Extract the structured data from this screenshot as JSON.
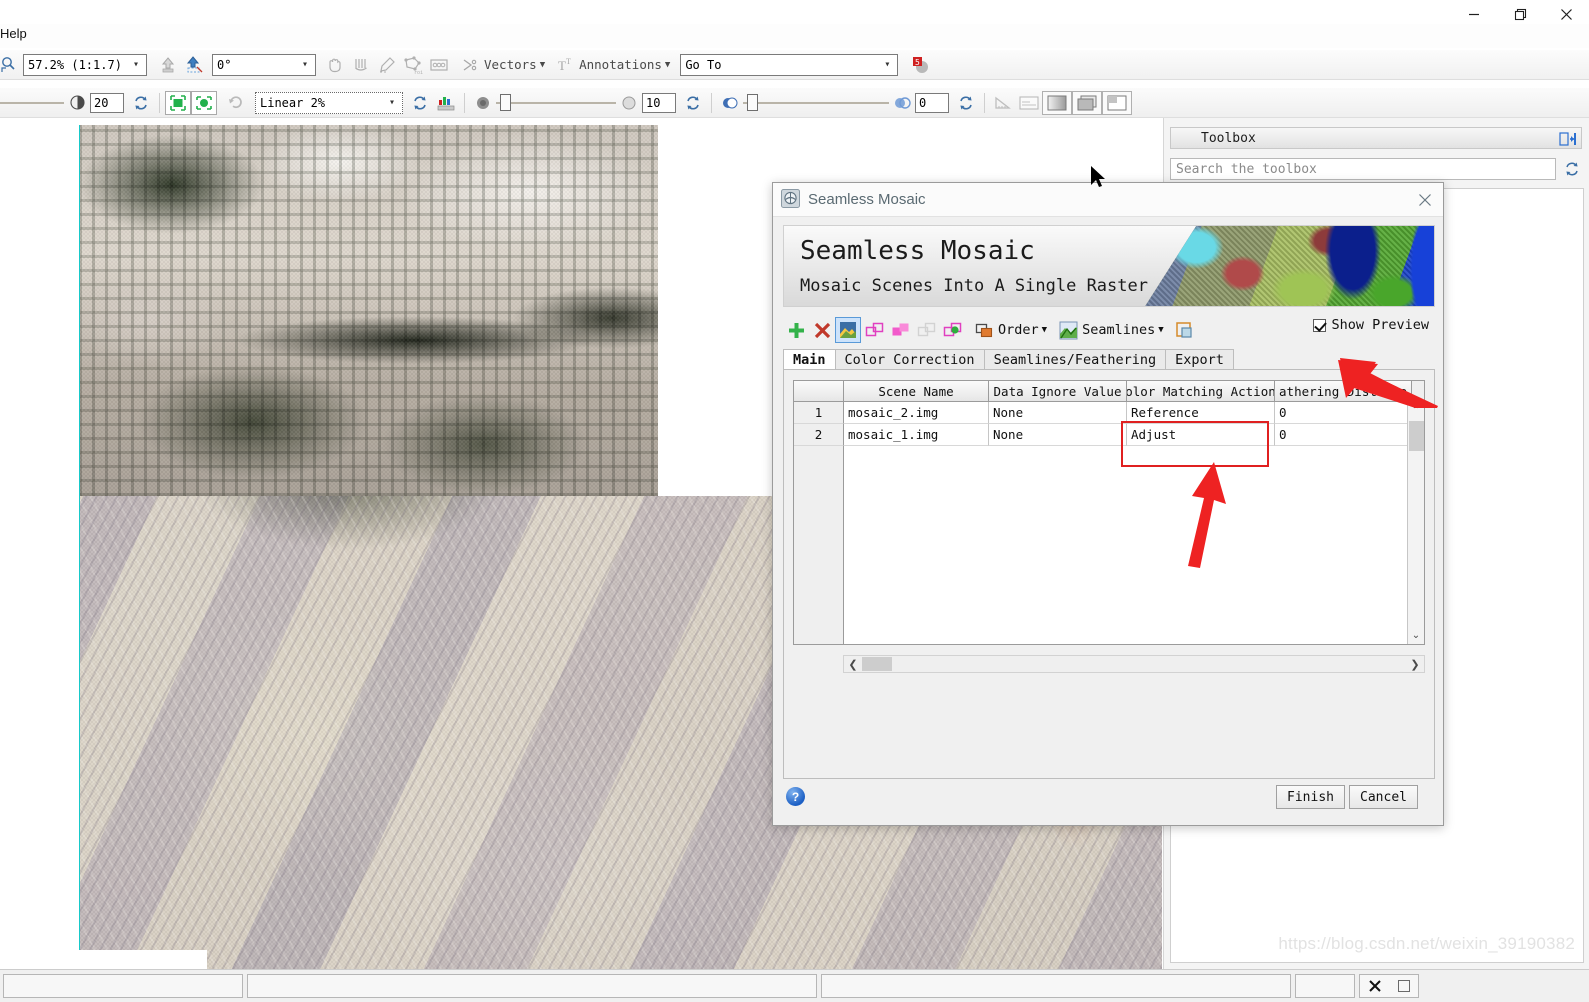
{
  "window": {
    "controls": [
      {
        "name": "minimize",
        "glyph": "—"
      },
      {
        "name": "restore",
        "glyph": "❐"
      },
      {
        "name": "close",
        "glyph": "✕"
      }
    ]
  },
  "menu": {
    "help_label": "Help"
  },
  "toolbar_main": {
    "zoom_combo_value": "57.2% (1:1.7)",
    "rotation_combo_value": "0°",
    "vectors_label": "Vectors",
    "annotations_label": "Annotations",
    "goto_value": "Go To",
    "icons": [
      "zoom-select-icon",
      "go-up-icon",
      "go-up-layer-icon",
      "pan-hand-icon",
      "crop-icon",
      "pencil-measure-icon",
      "roi-icon",
      "pixel-locator-icon",
      "vectors-icon",
      "annotations-icon",
      "envi-logo-icon"
    ]
  },
  "toolbar_display": {
    "contrast_value": "20",
    "stretch_value": "Linear 2%",
    "transparency_value": "10",
    "blend_value": "0",
    "icons": [
      "brightness-icon",
      "refresh-icon",
      "fit-to-window-icon",
      "fit-to-data-icon",
      "rotate-reset-icon",
      "stretch-refresh-icon",
      "histogram-icon",
      "transparency-icon",
      "blend-icon",
      "measure-icon",
      "view-metadata-icon",
      "view-single-icon",
      "view-stacked-icon",
      "view-portal-icon"
    ]
  },
  "viewport": {
    "layer_name": "satellite-mosaic-preview"
  },
  "toolbox": {
    "title": "Toolbox",
    "search_placeholder": "Search the toolbox",
    "pin_icon": "dock-pin-icon",
    "refresh_icon": "refresh-icon"
  },
  "watermark": {
    "text": "https://blog.csdn.net/weixin_39190382"
  },
  "dialog": {
    "title": "Seamless Mosaic",
    "close_glyph": "✕",
    "banner_title": "Seamless Mosaic",
    "banner_subtitle": "Mosaic Scenes Into A Single Raster",
    "toolbar": {
      "add_label": "add-scene",
      "remove_label": "remove-scene",
      "order_label": "Order",
      "seamlines_label": "Seamlines",
      "show_preview_label": "Show Preview",
      "show_preview_checked": true,
      "icons": [
        "add-plus-icon",
        "delete-x-icon",
        "image-properties-icon",
        "scene-outline-icon",
        "scene-filled-icon",
        "scene-blank-icon",
        "scene-green-icon",
        "order-icon",
        "seamlines-icon",
        "preview-extent-icon"
      ]
    },
    "tabs": [
      {
        "label": "Main",
        "active": true
      },
      {
        "label": "Color Correction",
        "active": false
      },
      {
        "label": "Seamlines/Feathering",
        "active": false
      },
      {
        "label": "Export",
        "active": false
      }
    ],
    "table": {
      "columns": [
        "",
        "Scene Name",
        "Data Ignore Value",
        "olor Matching Action",
        "athering Distance"
      ],
      "rows": [
        {
          "index": "1",
          "scene_name": "mosaic_2.img",
          "data_ignore_value": "None",
          "color_matching_action": "Reference",
          "feathering_distance": "0"
        },
        {
          "index": "2",
          "scene_name": "mosaic_1.img",
          "data_ignore_value": "None",
          "color_matching_action": "Adjust",
          "feathering_distance": "0"
        }
      ]
    },
    "help_glyph": "?",
    "finish_label": "Finish",
    "cancel_label": "Cancel",
    "highlight_color": "#e02020"
  },
  "annotations": {
    "arrow_color": "#ee2222",
    "arrow1_name": "pointer-to-show-preview",
    "arrow2_name": "pointer-to-color-matching-action"
  },
  "statusbar": {
    "cells": [
      "",
      "",
      "",
      ""
    ]
  }
}
